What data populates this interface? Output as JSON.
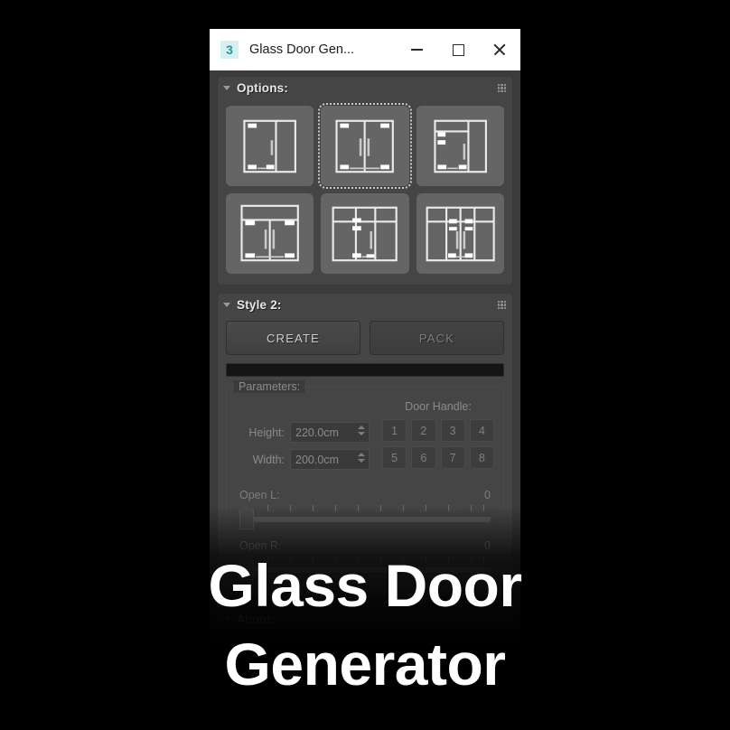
{
  "window": {
    "app_icon_label": "3",
    "title": "Glass Door Gen...",
    "controls": {
      "minimize": "minimize-icon",
      "maximize": "maximize-icon",
      "close": "close-icon"
    }
  },
  "options_rollout": {
    "title": "Options:",
    "grip_icon": "grip-dots-icon",
    "collapse_icon": "triangle-down-icon",
    "thumbnails": [
      {
        "id": 1,
        "name": "style-1",
        "selected": false
      },
      {
        "id": 2,
        "name": "style-2",
        "selected": true
      },
      {
        "id": 3,
        "name": "style-3",
        "selected": false
      },
      {
        "id": 4,
        "name": "style-4",
        "selected": false
      },
      {
        "id": 5,
        "name": "style-5",
        "selected": false
      },
      {
        "id": 6,
        "name": "style-6",
        "selected": false
      }
    ]
  },
  "style_rollout": {
    "title": "Style 2:",
    "grip_icon": "grip-dots-icon",
    "collapse_icon": "triangle-down-icon",
    "create_label": "CREATE",
    "pack_label": "PACK",
    "pack_disabled": true,
    "progress_value": 0
  },
  "parameters": {
    "legend": "Parameters:",
    "height_label": "Height:",
    "height_value": "220.0cm",
    "width_label": "Width:",
    "width_value": "200.0cm",
    "door_handle_label": "Door Handle:",
    "handle_buttons": [
      "1",
      "2",
      "3",
      "4",
      "5",
      "6",
      "7",
      "8"
    ]
  },
  "sliders": [
    {
      "label": "Open L:",
      "value": "0",
      "position_pct": 0
    },
    {
      "label": "Open R:",
      "value": "0",
      "position_pct": 0
    }
  ],
  "about_rollout": {
    "title": "About:"
  },
  "caption": {
    "line1": "Glass Door",
    "line2": "Generator"
  },
  "colors": {
    "panel_bg": "#3b3b3b",
    "rollout_bg": "#454545",
    "thumb_bg": "#656565",
    "accent_icon": "#169ba5",
    "title_bar": "#ffffff",
    "text_dim": "#8a8a8a"
  }
}
